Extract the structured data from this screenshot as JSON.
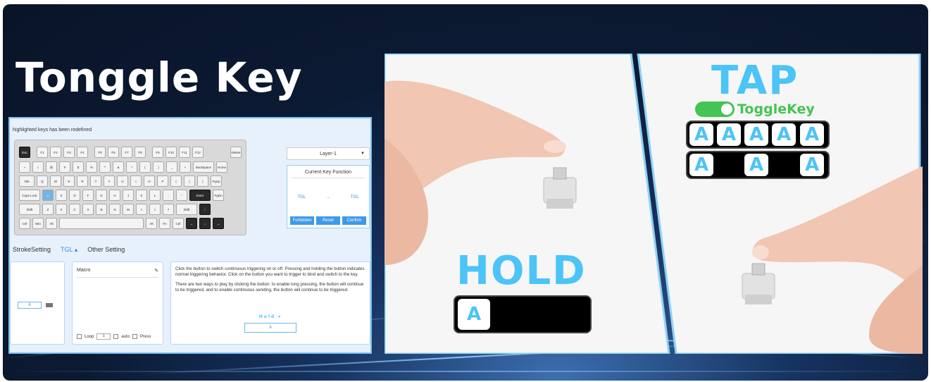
{
  "banner": {
    "title": "Tonggle Key",
    "accent_color": "#4cc4f7",
    "toggle_color": "#44c454"
  },
  "software": {
    "hint": "highlighted keys has been redefined",
    "layer_select": "Layer-1",
    "current_key_function": {
      "title": "Current Key Function",
      "from": "TGL",
      "arrow": "→",
      "to": "TGL",
      "buttons": [
        "Forbidden",
        "Reset",
        "Confirm"
      ]
    },
    "tabs": [
      {
        "label": "StrokeSetting",
        "active": false
      },
      {
        "label": "TGL",
        "active": true
      },
      {
        "label": "Other Setting",
        "active": false
      }
    ],
    "left_panel": {
      "key": "A"
    },
    "macro": {
      "title": "Macro",
      "loop_label": "Loop",
      "loop_value": "1",
      "auto_label": "auto",
      "press_label": "Press"
    },
    "description": {
      "p1": "Click the button to switch continuous triggering on or off. Pressing and holding the button indicates normal triggering behavior. Click on the button you want to trigger to bind and switch to the key.",
      "p2": "There are two ways to play by clicking the button: to enable long pressing, the button will continue to be triggered, and to enable continuous sending, the button will continue to be triggered.",
      "mode": "Hold",
      "key": "A"
    },
    "keyboard_rows": [
      [
        "Esc",
        "F1",
        "F2",
        "F3",
        "F4",
        "F5",
        "F6",
        "F7",
        "F8",
        "F9",
        "F10",
        "F11",
        "F12",
        "Delete"
      ],
      [
        "~",
        "!",
        "@",
        "#",
        "$",
        "%",
        "^",
        "&",
        "*",
        "(",
        ")",
        "_",
        "+",
        "Backspace",
        "Home"
      ],
      [
        "Tab",
        "Q",
        "W",
        "E",
        "R",
        "T",
        "Y",
        "U",
        "I",
        "O",
        "P",
        "{",
        "}",
        "|",
        "PgUp"
      ],
      [
        "Caps Lock",
        "A",
        "S",
        "D",
        "F",
        "G",
        "H",
        "J",
        "K",
        "L",
        ":",
        "\"",
        "Enter",
        "PgDn"
      ],
      [
        "Shift",
        "Z",
        "X",
        "C",
        "V",
        "B",
        "N",
        "M",
        "<",
        ">",
        "?",
        "Shift",
        "↑"
      ],
      [
        "Ctrl",
        "Win",
        "Alt",
        "",
        "Alt",
        "Fn",
        "Ctrl",
        "←",
        "↓",
        "→"
      ]
    ]
  },
  "hold_panel": {
    "label": "HOLD",
    "key": "A"
  },
  "tap_panel": {
    "label": "TAP",
    "toggle_label": "ToggleKey",
    "row1": [
      "A",
      "A",
      "A",
      "A",
      "A"
    ],
    "row2": [
      "A",
      "A",
      "A"
    ]
  }
}
